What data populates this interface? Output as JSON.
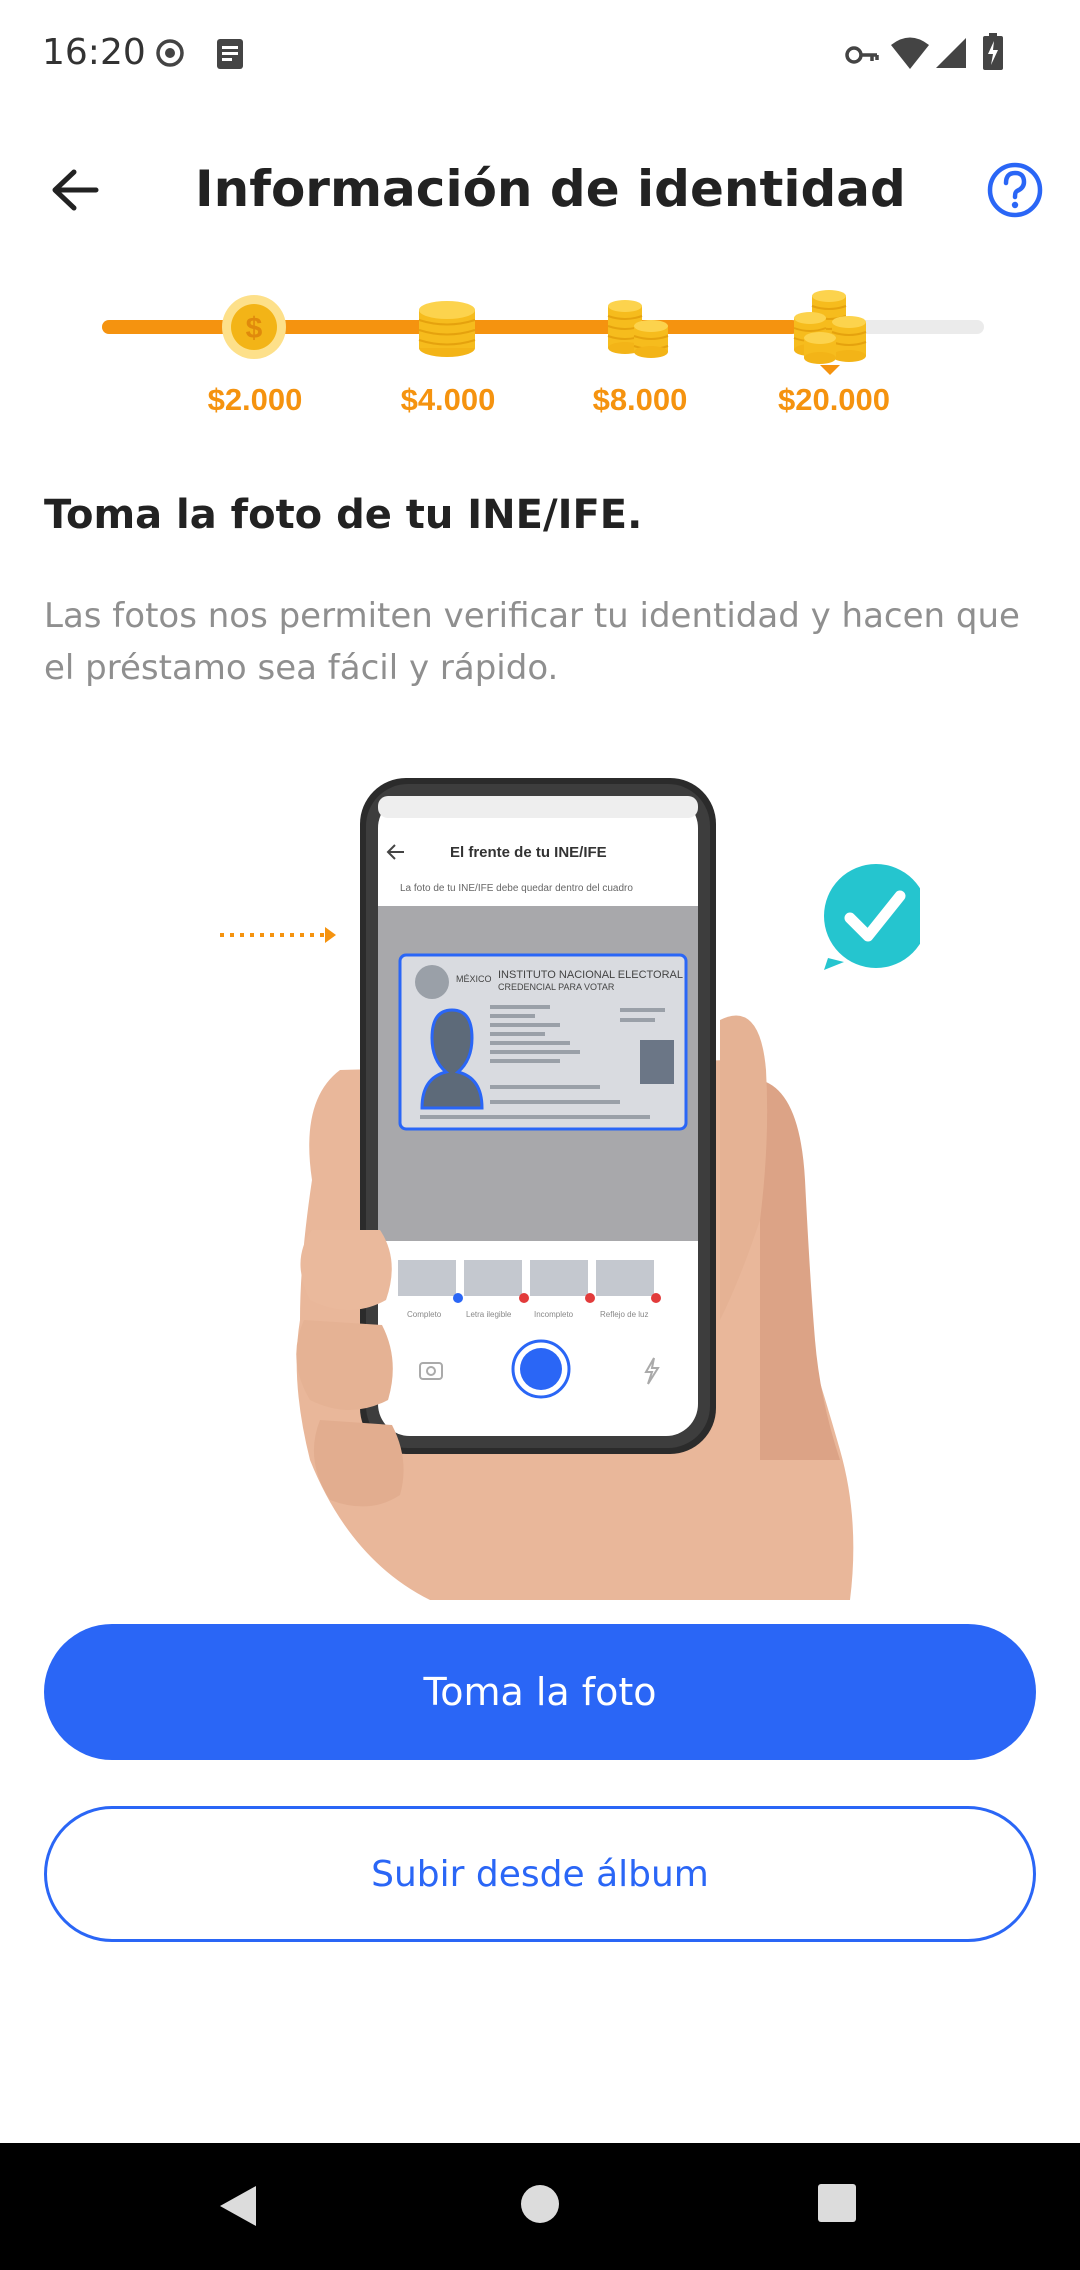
{
  "status_bar": {
    "time": "16:20",
    "icons": [
      "record-icon",
      "note-icon",
      "key-icon",
      "wifi-icon",
      "signal-icon",
      "battery-charging-icon"
    ]
  },
  "header": {
    "title": "Información de identidad",
    "back_icon": "back-arrow-icon",
    "help_icon": "help-icon"
  },
  "progress": {
    "fraction_complete": 0.79,
    "steps": [
      {
        "amount": "$2.000",
        "icon": "coin-icon"
      },
      {
        "amount": "$4.000",
        "icon": "coin-stack-icon"
      },
      {
        "amount": "$8.000",
        "icon": "coin-stacks-icon"
      },
      {
        "amount": "$20.000",
        "icon": "coin-pile-icon",
        "current": true
      }
    ],
    "accent_color": "#f5930f"
  },
  "content": {
    "title": "Toma la foto de tu INE/IFE.",
    "description": "Las fotos nos permiten verificar tu identidad y hacen que el préstamo sea fácil y rápido."
  },
  "illustration": {
    "screen_title": "El frente de tu INE/IFE",
    "screen_hint": "La foto de tu INE/IFE debe quedar dentro del cuadro",
    "card_country": "MÉXICO",
    "card_line1": "INSTITUTO NACIONAL ELECTORAL",
    "card_line2": "CREDENCIAL PARA VOTAR",
    "thumbnails": [
      "Completo",
      "Letra ilegible",
      "Incompleto",
      "Reflejo de luz"
    ]
  },
  "actions": {
    "primary_label": "Toma la foto",
    "secondary_label": "Subir desde álbum",
    "brand_color": "#2a66f6"
  },
  "nav_bar": {
    "icons": [
      "nav-back-icon",
      "nav-home-icon",
      "nav-recents-icon"
    ]
  }
}
